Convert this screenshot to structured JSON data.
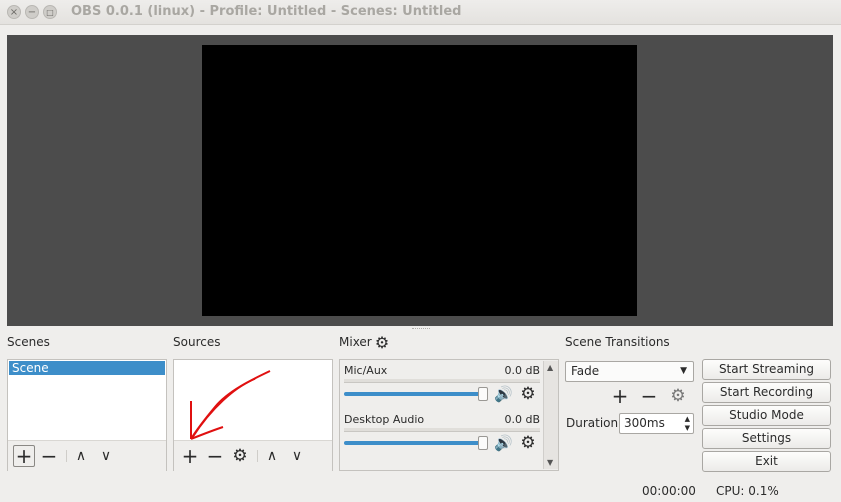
{
  "window": {
    "title": "OBS 0.0.1 (linux) - Profile: Untitled - Scenes: Untitled",
    "close": "×",
    "minimize": "−",
    "maximize": "□"
  },
  "scenes": {
    "title": "Scenes",
    "items": [
      "Scene"
    ],
    "toolbar": {
      "add": "+",
      "remove": "−",
      "up": "∧",
      "down": "∨"
    }
  },
  "sources": {
    "title": "Sources",
    "items": [],
    "toolbar": {
      "add": "+",
      "remove": "−",
      "properties": "⚙",
      "up": "∧",
      "down": "∨"
    }
  },
  "mixer": {
    "title": "Mixer",
    "channels": [
      {
        "name": "Mic/Aux",
        "db": "0.0 dB",
        "volume": 1.0
      },
      {
        "name": "Desktop Audio",
        "db": "0.0 dB",
        "volume": 1.0
      }
    ]
  },
  "transitions": {
    "title": "Scene Transitions",
    "selected": "Fade",
    "duration_label": "Duration",
    "duration_value": "300ms"
  },
  "controls": {
    "start_streaming": "Start Streaming",
    "start_recording": "Start Recording",
    "studio_mode": "Studio Mode",
    "settings": "Settings",
    "exit": "Exit"
  },
  "status": {
    "time": "00:00:00",
    "cpu": "CPU: 0.1%"
  },
  "colors": {
    "selection": "#3d8ec9",
    "preview_bg": "#4c4c4c",
    "annotation": "#e01010"
  }
}
